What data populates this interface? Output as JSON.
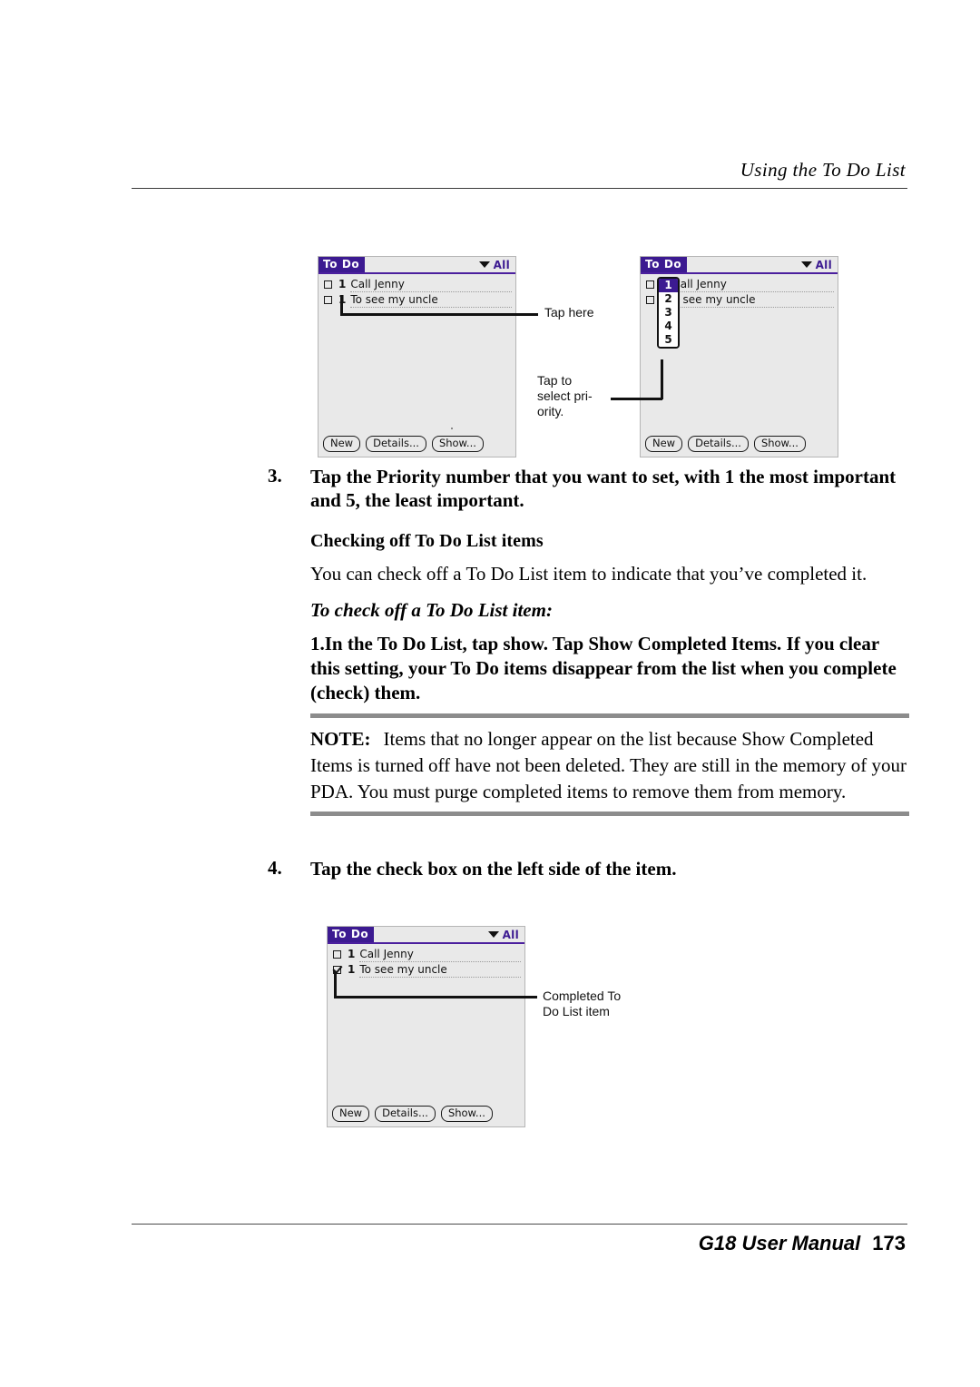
{
  "header": {
    "title": "Using the To Do List"
  },
  "footer": {
    "manual": "G18 User Manual",
    "page_number": "173"
  },
  "colors": {
    "pda_title_purple": "#3c1a91",
    "pda_screen_bg": "#e9e9e9",
    "note_rule_gray": "#8c8c8c"
  },
  "steps": {
    "step3_num": "3.",
    "step3_text": "Tap the Priority number that you want to set, with 1 the most important and 5, the least important.",
    "step4_num": "4.",
    "step4_text": "Tap the check box on the left side of the item."
  },
  "sections": {
    "checking_off_heading": "Checking off To Do List items",
    "checking_off_para": "You can check off a To Do List item to indicate that you’ve completed it.",
    "to_check_off_heading": "To check off a To Do List item:",
    "step1_text": "1.In the To Do List, tap show. Tap Show Completed Items. If you clear this setting, your To Do items disappear from the list when you complete (check) them."
  },
  "note": {
    "label": "NOTE:",
    "text": "Items that no longer appear on the list because Show Completed Items is turned off have not been deleted. They are still in the memory of your PDA. You must purge completed items to remove them from memory."
  },
  "pda": {
    "app_title": "To Do",
    "category": "All",
    "buttons": [
      {
        "label": "New"
      },
      {
        "label": "Details..."
      },
      {
        "label": "Show..."
      }
    ],
    "priority_options": [
      "1",
      "2",
      "3",
      "4",
      "5"
    ],
    "priority_selected": "1"
  },
  "pda_top_left": {
    "items": [
      {
        "priority": "1",
        "text": "Call Jenny",
        "checked": false
      },
      {
        "priority": "1",
        "text": "To see my uncle",
        "checked": false
      }
    ]
  },
  "pda_top_right": {
    "items": [
      {
        "priority": "1",
        "text": "Call Jenny",
        "checked": false
      },
      {
        "priority": "1",
        "text": "o see my uncle",
        "checked": false
      }
    ]
  },
  "pda_bottom": {
    "items": [
      {
        "priority": "1",
        "text": "Call Jenny",
        "checked": false
      },
      {
        "priority": "1",
        "text": "To see my uncle",
        "checked": true
      }
    ]
  },
  "callouts": {
    "tap_here": "Tap here",
    "tap_to_select_priority": "Tap to\nselect pri-\nority.",
    "completed_item": "Completed To\nDo List item"
  }
}
